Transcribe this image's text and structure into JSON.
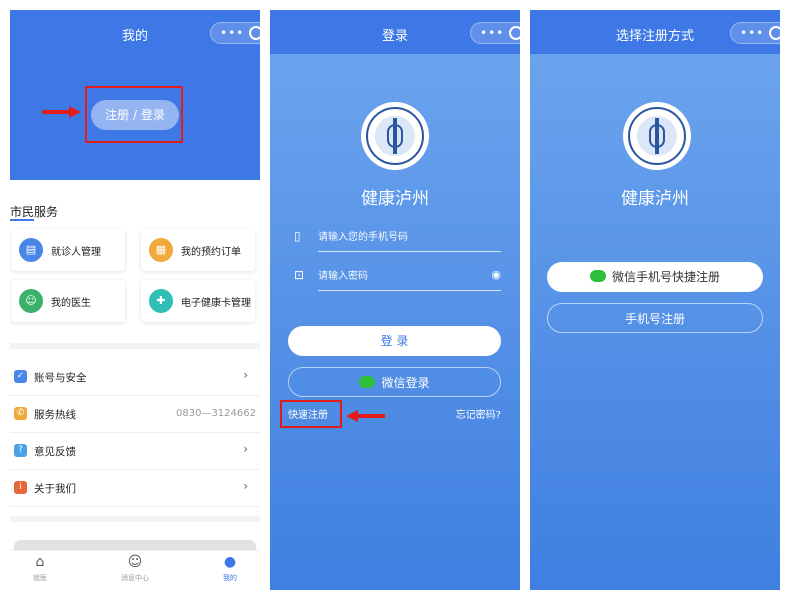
{
  "panels": {
    "me": {
      "nav_title": "我的",
      "login_button": "注册 / 登录",
      "section_title": "市民服务",
      "services": [
        {
          "label": "就诊人管理",
          "icon": "id-card-icon",
          "color": "#4a86e8"
        },
        {
          "label": "我的预约订单",
          "icon": "calendar-icon",
          "color": "#f0a93b"
        },
        {
          "label": "我的医生",
          "icon": "doctor-icon",
          "color": "#3bb26b"
        },
        {
          "label": "电子健康卡管理",
          "icon": "health-card-icon",
          "color": "#2fbfb5"
        }
      ],
      "rows": [
        {
          "label": "账号与安全",
          "icon": "shield-icon",
          "color": "#4a86e8"
        },
        {
          "label": "服务热线",
          "icon": "phone-icon",
          "color": "#f0a93b",
          "value": "0830—3124662"
        },
        {
          "label": "意见反馈",
          "icon": "feedback-icon",
          "color": "#4aa3e8"
        },
        {
          "label": "关于我们",
          "icon": "info-icon",
          "color": "#e8663c"
        }
      ],
      "tabs": [
        {
          "label": "就医",
          "icon": "hospital-icon"
        },
        {
          "label": "消息中心",
          "icon": "message-icon"
        },
        {
          "label": "我的",
          "icon": "user-icon"
        }
      ]
    },
    "login": {
      "nav_title": "登录",
      "app_name": "健康泸州",
      "phone_placeholder": "请输入您的手机号码",
      "password_placeholder": "请输入密码",
      "login_button": "登 录",
      "wechat_login": "微信登录",
      "quick_register": "快速注册",
      "forgot_password": "忘记密码?"
    },
    "register": {
      "nav_title": "选择注册方式",
      "app_name": "健康泸州",
      "wechat_register": "微信手机号快捷注册",
      "phone_register": "手机号注册"
    }
  },
  "colors": {
    "primary": "#3d78e6",
    "highlight": "#e21b1b",
    "wechat": "#2fbf3b"
  }
}
